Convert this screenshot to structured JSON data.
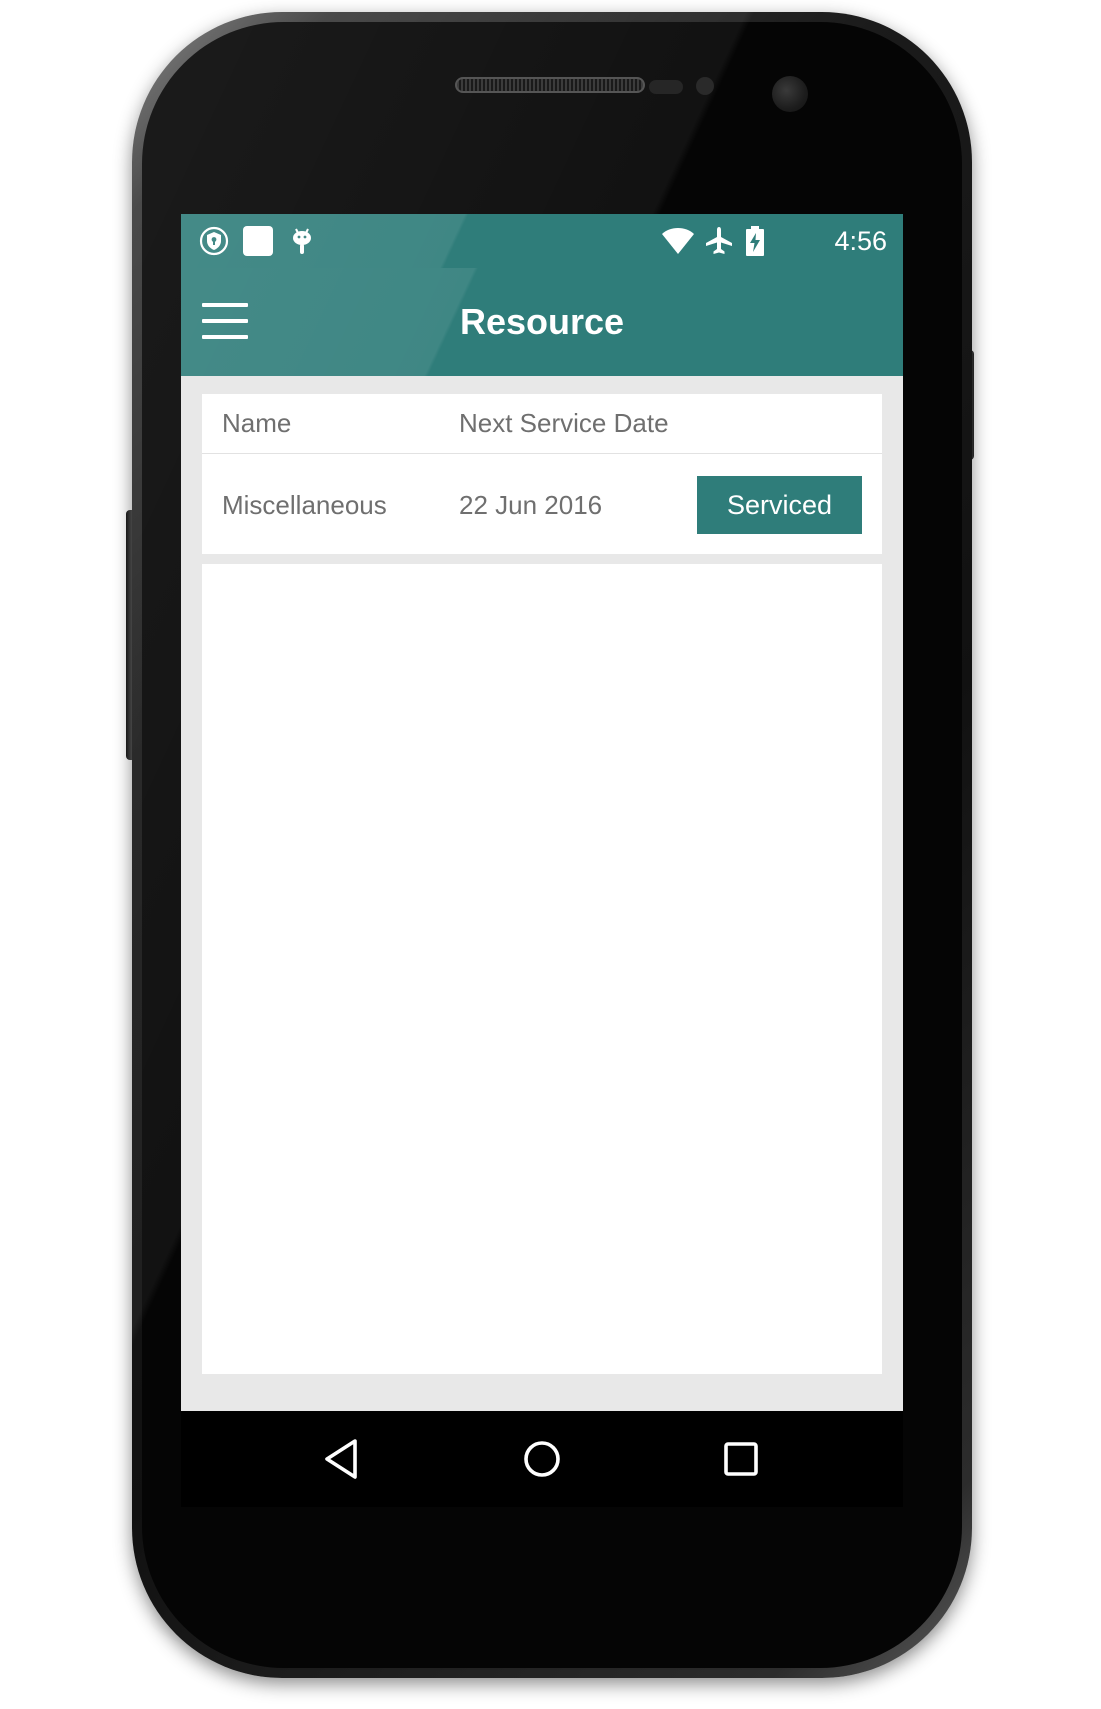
{
  "status_bar": {
    "time": "4:56",
    "left_icons": [
      "vpn-shield-icon",
      "notification-square-icon",
      "android-debug-icon"
    ],
    "right_icons": [
      "wifi-icon",
      "airplane-mode-icon",
      "battery-charging-icon"
    ]
  },
  "app_bar": {
    "title": "Resource",
    "menu_icon": "hamburger-menu-icon"
  },
  "table": {
    "columns": [
      "Name",
      "Next Service Date"
    ],
    "rows": [
      {
        "name": "Miscellaneous",
        "next_service_date": "22 Jun 2016",
        "action_label": "Serviced"
      }
    ]
  },
  "nav_bar": {
    "buttons": [
      "back-icon",
      "home-icon",
      "recents-icon"
    ]
  },
  "colors": {
    "primary": "#2f7d7a",
    "background": "#e8e8e8",
    "card": "#ffffff",
    "text_secondary": "#6f6f6f"
  }
}
